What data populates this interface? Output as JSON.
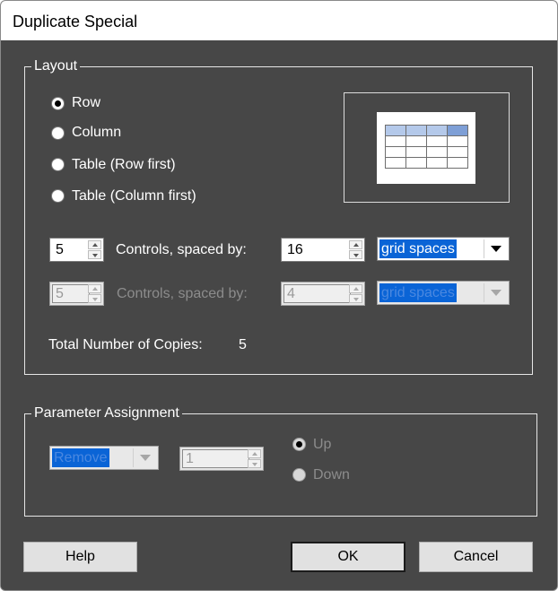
{
  "window": {
    "title": "Duplicate Special"
  },
  "layout_group": {
    "legend": "Layout",
    "radios": [
      {
        "label": "Row",
        "checked": true
      },
      {
        "label": "Column",
        "checked": false
      },
      {
        "label": "Table (Row first)",
        "checked": false
      },
      {
        "label": "Table (Column first)",
        "checked": false
      }
    ],
    "preview_icon": "table-preview-icon",
    "row1": {
      "count": "5",
      "label": "Controls, spaced by:",
      "spacing": "16",
      "unit": "grid spaces",
      "enabled": true
    },
    "row2": {
      "count": "5",
      "label": "Controls, spaced by:",
      "spacing": "4",
      "unit": "grid spaces",
      "enabled": false
    },
    "total_label": "Total Number of Copies:",
    "total_value": "5"
  },
  "param_group": {
    "legend": "Parameter Assignment",
    "mode": "Remove",
    "step": "1",
    "radios": [
      {
        "label": "Up",
        "checked": true
      },
      {
        "label": "Down",
        "checked": false
      }
    ],
    "enabled": false
  },
  "buttons": {
    "help": "Help",
    "ok": "OK",
    "cancel": "Cancel"
  },
  "colors": {
    "dialog_bg": "#474747",
    "selection": "#0a64d6",
    "preview_header": "#b4c9ea"
  }
}
